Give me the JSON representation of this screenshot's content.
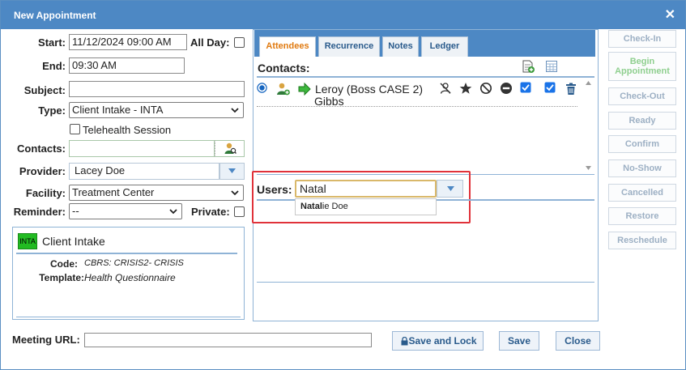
{
  "window": {
    "title": "New Appointment",
    "close_icon": "close-icon"
  },
  "form": {
    "start_label": "Start:",
    "start_value": "11/12/2024 09:00 AM",
    "allday_label": "All Day:",
    "end_label": "End:",
    "end_value": "09:30 AM",
    "subject_label": "Subject:",
    "subject_value": "",
    "type_label": "Type:",
    "type_value": "Client Intake - INTA",
    "telehealth_label": "Telehealth Session",
    "contacts_label": "Contacts:",
    "contacts_value": "",
    "provider_label": "Provider:",
    "provider_value": "Lacey Doe",
    "facility_label": "Facility:",
    "facility_value": "Treatment Center",
    "reminder_label": "Reminder:",
    "reminder_value": "--",
    "private_label": "Private:"
  },
  "type_card": {
    "badge": "INTA",
    "badge_color": "#22bb22",
    "title": "Client Intake",
    "code_label": "Code:",
    "code_value": "CBRS: CRISIS2- CRISIS",
    "template_label": "Template:",
    "template_value": "Health Questionnaire"
  },
  "tabs": [
    {
      "label": "Attendees",
      "active": true
    },
    {
      "label": "Recurrence",
      "active": false
    },
    {
      "label": "Notes",
      "active": false
    },
    {
      "label": "Ledger",
      "active": false
    }
  ],
  "attendees": {
    "contacts_label": "Contacts:",
    "contact_name_line1": "Leroy (Boss CASE 2)",
    "contact_name_line2": "Gibbs",
    "users_label": "Users:",
    "users_input": "Natal",
    "suggestion_match": "Natal",
    "suggestion_rest": "ie Doe",
    "highlight_color": "#e0323a"
  },
  "side_buttons": [
    "Check-In",
    "Begin Appointment",
    "Check-Out",
    "Ready",
    "Confirm",
    "No-Show",
    "Cancelled",
    "Restore",
    "Reschedule"
  ],
  "footer": {
    "meeting_url_label": "Meeting URL:",
    "meeting_url_value": "",
    "save_lock_label": "Save and Lock",
    "save_label": "Save",
    "close_label": "Close"
  }
}
